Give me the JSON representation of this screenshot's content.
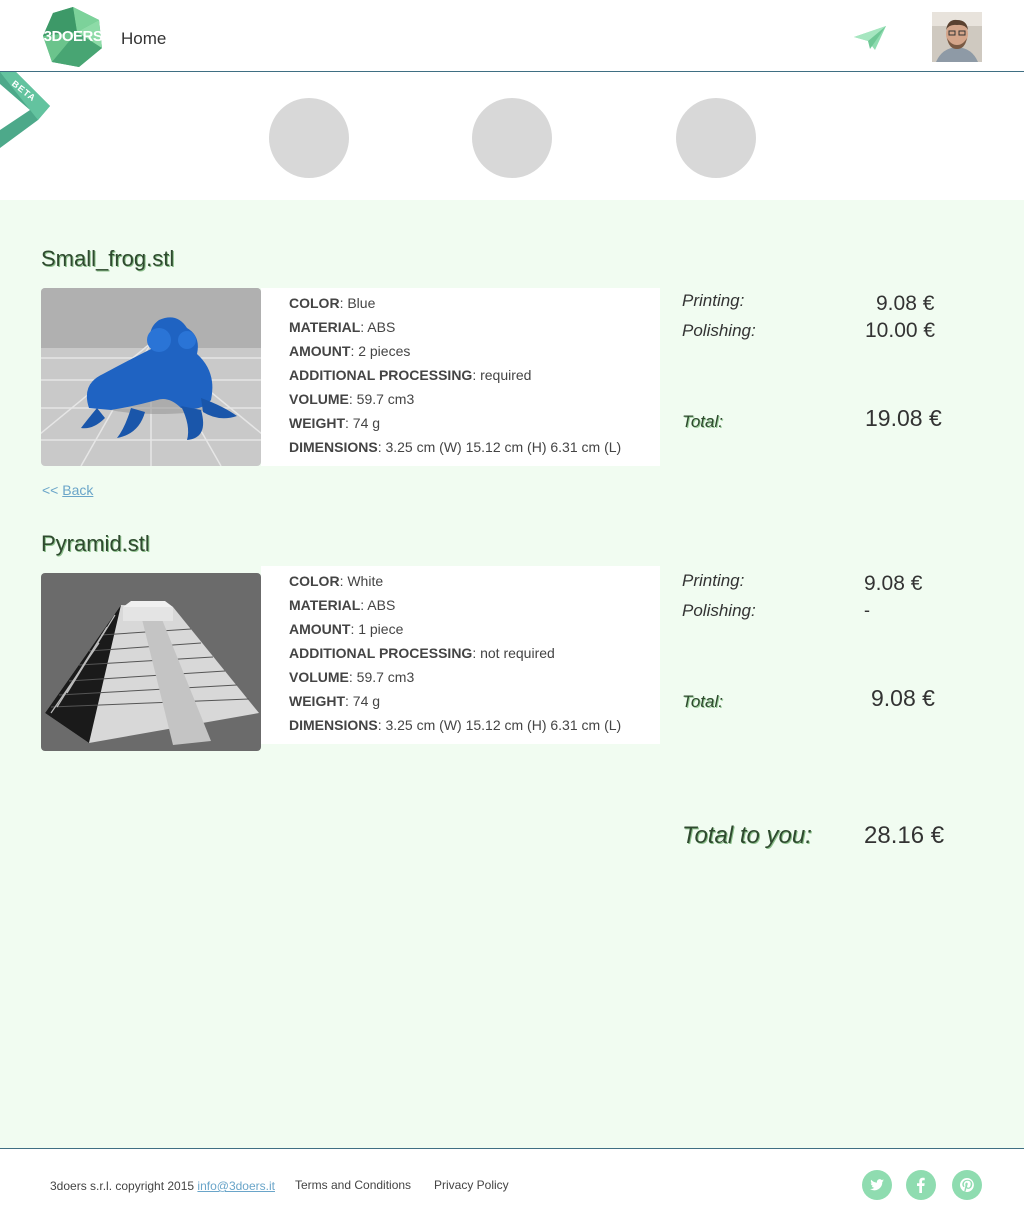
{
  "header": {
    "logo_text": "3DOERS",
    "home_label": "Home",
    "send_icon": "paper-plane-icon",
    "avatar_icon": "user-avatar-icon"
  },
  "beta_label": "BETA",
  "steps": [
    "step-1",
    "step-2",
    "step-3"
  ],
  "items": [
    {
      "file_name": "Small_frog.stl",
      "thumb_icon": "frog-model-icon",
      "color_label": "COLOR",
      "color_value": ": Blue",
      "material_label": "MATERIAL",
      "material_value": ": ABS",
      "amount_label": "AMOUNT",
      "amount_value": ":  2 pieces",
      "processing_label": "ADDITIONAL PROCESSING",
      "processing_value": ":  required",
      "volume_label": "VOLUME",
      "volume_value": ": 59.7 cm3",
      "weight_label": "WEIGHT",
      "weight_value": ": 74 g",
      "dimensions_label": "DIMENSIONS",
      "dimensions_value": ": 3.25 cm (W) 15.12 cm (H) 6.31 cm (L)",
      "printing_label": "Printing:",
      "printing_value": "9.08 €",
      "polishing_label": "Polishing:",
      "polishing_value": "10.00 €",
      "total_label": "Total:",
      "total_value": "19.08 €"
    },
    {
      "file_name": "Pyramid.stl",
      "thumb_icon": "pyramid-model-icon",
      "color_label": "COLOR",
      "color_value": ": White",
      "material_label": "MATERIAL",
      "material_value": ": ABS",
      "amount_label": "AMOUNT",
      "amount_value": ":  1 piece",
      "processing_label": "ADDITIONAL PROCESSING",
      "processing_value": ":  not required",
      "volume_label": "VOLUME",
      "volume_value": ": 59.7 cm3",
      "weight_label": "WEIGHT",
      "weight_value": ": 74 g",
      "dimensions_label": "DIMENSIONS",
      "dimensions_value": ": 3.25 cm (W) 15.12 cm (H) 6.31 cm (L)",
      "printing_label": "Printing:",
      "printing_value": "9.08 €",
      "polishing_label": "Polishing:",
      "polishing_value": "-",
      "total_label": "Total:",
      "total_value": "9.08 €"
    }
  ],
  "back": {
    "prefix": "<< ",
    "label": "Back"
  },
  "grand_total": {
    "label": "Total to you:",
    "value": "28.16 €"
  },
  "footer": {
    "copyright": "3doers s.r.l. copyright 2015 ",
    "email": "info@3doers.it",
    "terms": "Terms and Conditions",
    "privacy": "Privacy Policy",
    "social": [
      "twitter-icon",
      "facebook-icon",
      "pinterest-icon"
    ]
  },
  "colors": {
    "accent": "#8fdcb0",
    "content_bg": "#f1fcf1",
    "border": "#3f6f83",
    "link": "#6aa5c9",
    "step": "#d8d8d8"
  }
}
